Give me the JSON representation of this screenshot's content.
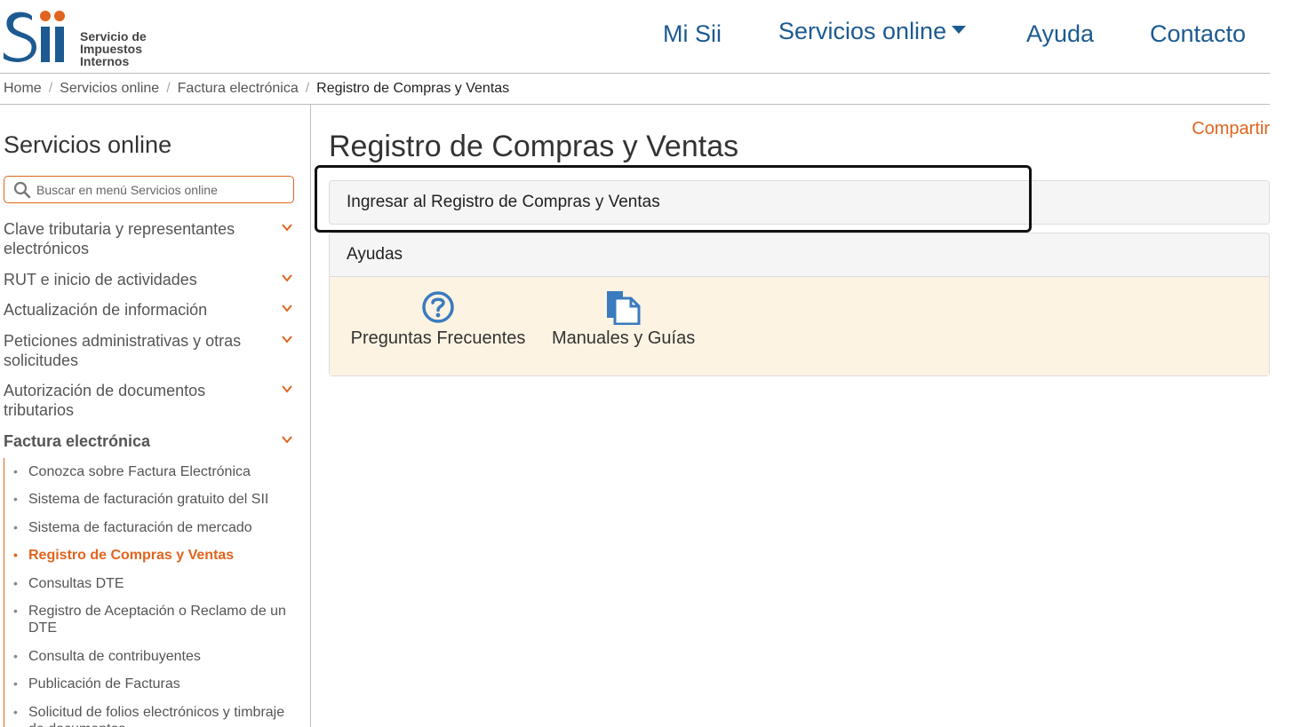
{
  "header": {
    "logo": {
      "text_line1": "Servicio de",
      "text_line2": "Impuestos",
      "text_line3": "Internos",
      "brand_blue": "#1c5a91",
      "brand_orange": "#e0641e"
    },
    "nav": {
      "mi_sii": "Mi Sii",
      "servicios_online": "Servicios online",
      "ayuda": "Ayuda",
      "contacto": "Contacto"
    }
  },
  "breadcrumb": {
    "home": "Home",
    "servicios": "Servicios online",
    "factura": "Factura electrónica",
    "current": "Registro de Compras y Ventas"
  },
  "sidebar": {
    "title": "Servicios online",
    "search_placeholder": "Buscar en menú Servicios online",
    "items": [
      {
        "label": "Clave tributaria y representantes electrónicos"
      },
      {
        "label": "RUT e inicio de actividades"
      },
      {
        "label": "Actualización de información"
      },
      {
        "label": "Peticiones administrativas y otras solicitudes"
      },
      {
        "label": "Autorización de documentos tributarios"
      },
      {
        "label": "Factura electrónica"
      }
    ],
    "subitems": [
      {
        "label": "Conozca sobre Factura Electrónica"
      },
      {
        "label": "Sistema de facturación gratuito del SII"
      },
      {
        "label": "Sistema de facturación de mercado"
      },
      {
        "label": "Registro de Compras y Ventas"
      },
      {
        "label": "Consultas DTE"
      },
      {
        "label": "Registro de Aceptación o Reclamo de un DTE"
      },
      {
        "label": "Consulta de contribuyentes"
      },
      {
        "label": "Publicación de Facturas"
      },
      {
        "label": "Solicitud de folios electrónicos y timbraje de documentos"
      }
    ]
  },
  "main": {
    "compartir": "Compartir",
    "title": "Registro de Compras y Ventas",
    "ingresar_label": "Ingresar al Registro de Compras y Ventas",
    "ayudas": {
      "heading": "Ayudas",
      "faq_label": "Preguntas Frecuentes",
      "faq_icon": "question-circle-icon",
      "manual_label": "Manuales y Guías",
      "manual_icon": "documents-icon"
    }
  }
}
